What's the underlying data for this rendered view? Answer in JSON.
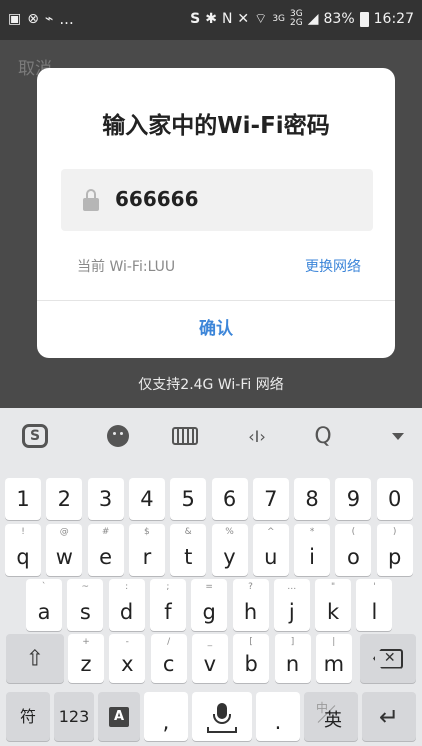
{
  "status_bar": {
    "left_icons": [
      "image-icon",
      "notification-icon",
      "usb-icon"
    ],
    "ellipsis": "...",
    "right_icons": [
      "sogou-icon",
      "bluetooth-icon",
      "nfc-icon",
      "mute-icon",
      "wifi-icon"
    ],
    "net_3g": "3G",
    "net_3g2": "3G",
    "net_2g": "2G",
    "battery": "83%",
    "time": "16:27"
  },
  "page": {
    "cancel_label": "取消",
    "wifi_support_note": "仅支持2.4G Wi-Fi 网络"
  },
  "dialog": {
    "title": "输入家中的Wi-Fi密码",
    "password_value": "666666",
    "current_wifi": "当前 Wi-Fi:LUU",
    "change_network": "更换网络",
    "confirm": "确认"
  },
  "keyboard": {
    "toolbar": [
      "sogou-logo-icon",
      "emoji-icon",
      "keyboard-icon",
      "cursor-icon",
      "search-icon",
      "collapse-icon"
    ],
    "cursor_glyph": "‹I›",
    "search_glyph": "Q",
    "numbers": [
      "1",
      "2",
      "3",
      "4",
      "5",
      "6",
      "7",
      "8",
      "9",
      "0"
    ],
    "row1": [
      {
        "main": "q",
        "sub": "!"
      },
      {
        "main": "w",
        "sub": "@"
      },
      {
        "main": "e",
        "sub": "#"
      },
      {
        "main": "r",
        "sub": "$"
      },
      {
        "main": "t",
        "sub": "&"
      },
      {
        "main": "y",
        "sub": "%"
      },
      {
        "main": "u",
        "sub": "^"
      },
      {
        "main": "i",
        "sub": "*"
      },
      {
        "main": "o",
        "sub": "("
      },
      {
        "main": "p",
        "sub": ")"
      }
    ],
    "row2": [
      {
        "main": "a",
        "sub": "`"
      },
      {
        "main": "s",
        "sub": "~"
      },
      {
        "main": "d",
        "sub": ":"
      },
      {
        "main": "f",
        "sub": ";"
      },
      {
        "main": "g",
        "sub": "="
      },
      {
        "main": "h",
        "sub": "?"
      },
      {
        "main": "j",
        "sub": "…"
      },
      {
        "main": "k",
        "sub": "\""
      },
      {
        "main": "l",
        "sub": "'"
      }
    ],
    "row3": [
      {
        "main": "z",
        "sub": "+"
      },
      {
        "main": "x",
        "sub": "-"
      },
      {
        "main": "c",
        "sub": "/"
      },
      {
        "main": "v",
        "sub": "_"
      },
      {
        "main": "b",
        "sub": "["
      },
      {
        "main": "n",
        "sub": "]"
      },
      {
        "main": "m",
        "sub": "|"
      }
    ],
    "shift_glyph": "⇧",
    "symbol_key": "符",
    "number_key": "123",
    "a_key": "A",
    "comma_key": ",",
    "period_key": ".",
    "lang_sub": "中",
    "lang_main": "英",
    "enter_glyph": "↵"
  }
}
